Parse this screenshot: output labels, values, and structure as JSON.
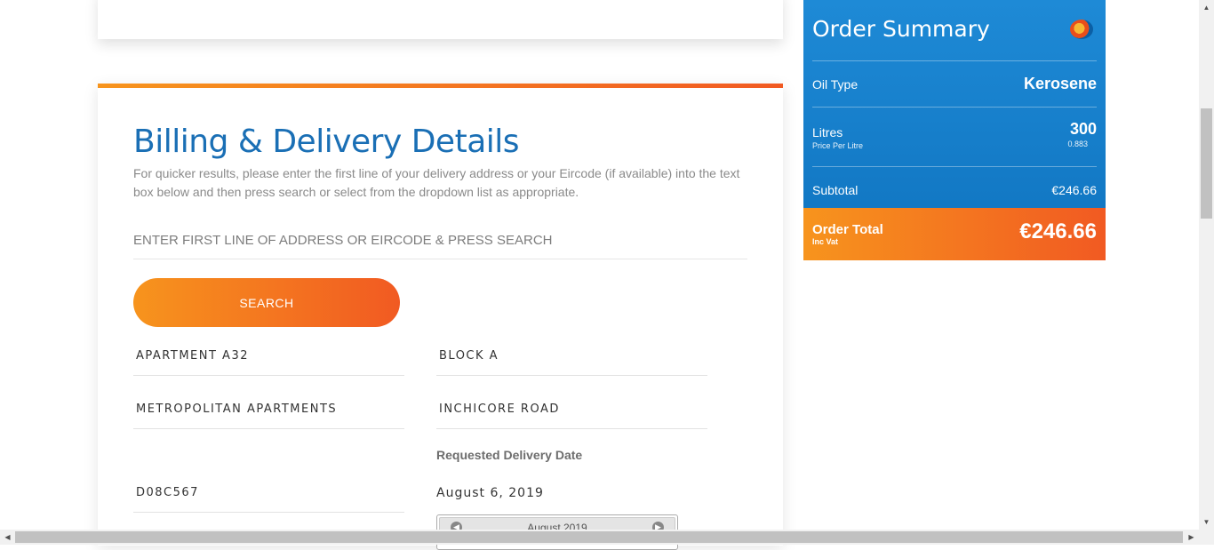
{
  "billing": {
    "title": "Billing & Delivery Details",
    "instructions": "For quicker results, please enter the first line of your delivery address or your Eircode (if available) into the text box below and then press search or select from the dropdown list as appropriate.",
    "search_placeholder": "ENTER FIRST LINE OF ADDRESS OR EIRCODE & PRESS SEARCH",
    "search_button": "SEARCH",
    "address": {
      "line1": "APARTMENT A32",
      "line2": "BLOCK A",
      "line3": "METROPOLITAN APARTMENTS",
      "line4": "INCHICORE ROAD",
      "eircode": "D08C567"
    },
    "delivery_date_label": "Requested Delivery Date",
    "delivery_date": "August 6, 2019",
    "calendar_month": "August 2019"
  },
  "summary": {
    "title": "Order Summary",
    "oil_type_label": "Oil Type",
    "oil_type": "Kerosene",
    "litres_label": "Litres",
    "litres": "300",
    "price_per_litre_label": "Price Per Litre",
    "price_per_litre": "0.883",
    "subtotal_label": "Subtotal",
    "subtotal": "€246.66",
    "total_label": "Order Total",
    "total_sublabel": "Inc Vat",
    "total": "€246.66"
  },
  "colors": {
    "brand_blue": "#1a6fb5",
    "accent_orange": "#f15a22",
    "summary_blue": "#1278c4"
  }
}
